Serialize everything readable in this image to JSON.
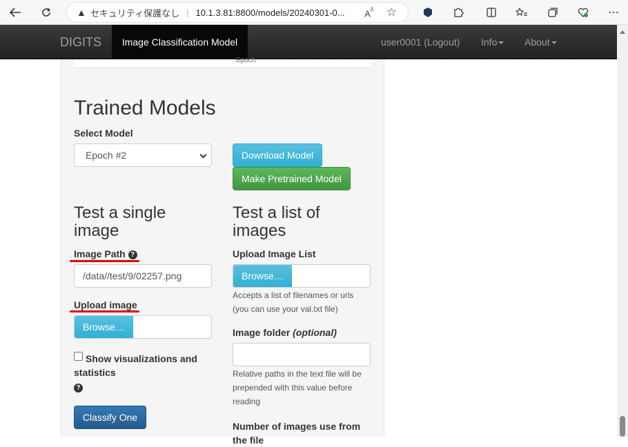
{
  "browser": {
    "security_label": "セキュリティ保護なし",
    "url": "10.1.3.81:8800/models/20240301-0..."
  },
  "navbar": {
    "brand": "DIGITS",
    "active_page": "Image Classification Model",
    "user": "user0001 (Logout)",
    "info": "Info",
    "about": "About"
  },
  "chart_strip": {
    "axis_label": "Epoch"
  },
  "trained_models": {
    "heading": "Trained Models",
    "select_label": "Select Model",
    "selected_model": "Epoch #2",
    "download_button": "Download Model",
    "pretrained_button": "Make Pretrained Model"
  },
  "single_image": {
    "heading": "Test a single image",
    "image_path_label": "Image Path",
    "image_path_value": "/data//test/9/02257.png",
    "upload_label": "Upload image",
    "browse_label": "Browse…",
    "visualize_label": "Show visualizations and statistics",
    "classify_button": "Classify One"
  },
  "list_images": {
    "heading": "Test a list of images",
    "upload_list_label": "Upload Image List",
    "browse_label": "Browse…",
    "upload_help": "Accepts a list of filenames or urls (you can use your val.txt file)",
    "folder_label": "Image folder",
    "folder_optional": "(optional)",
    "folder_help": "Relative paths in the text file will be prepended with this value before reading",
    "number_label": "Number of images use from the file"
  },
  "colors": {
    "navbar_bg": "#222222",
    "info_button": "#31b0d5",
    "success_button": "#419641",
    "primary_button": "#265a88",
    "annotation_underline": "#e00000"
  }
}
